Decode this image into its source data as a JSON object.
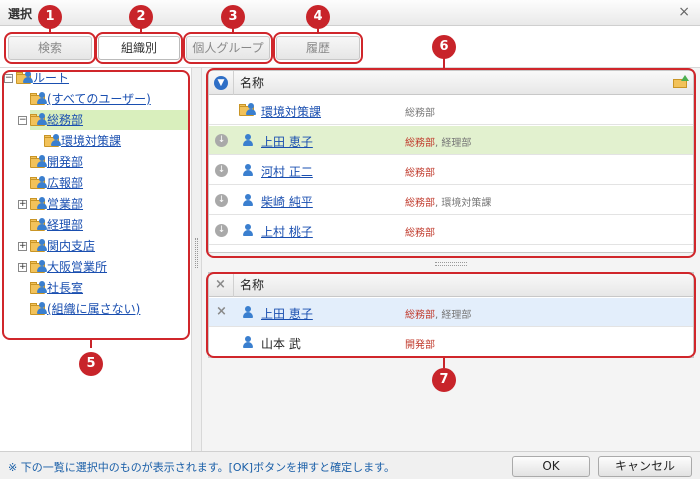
{
  "dialog": {
    "title": "選択",
    "close_glyph": "×"
  },
  "tabs": [
    {
      "label": "検索",
      "badge": "1"
    },
    {
      "label": "組織別",
      "badge": "2"
    },
    {
      "label": "個人グループ",
      "badge": "3"
    },
    {
      "label": "履歴",
      "badge": "4"
    }
  ],
  "tree": {
    "badge": "5",
    "items": [
      {
        "label": "ルート",
        "toggle": "−"
      },
      {
        "label": "(すべてのユーザー)"
      },
      {
        "label": "総務部",
        "toggle": "−"
      },
      {
        "label": "環境対策課"
      },
      {
        "label": "開発部"
      },
      {
        "label": "広報部"
      },
      {
        "label": "営業部",
        "toggle": "+"
      },
      {
        "label": "経理部"
      },
      {
        "label": "関内支店",
        "toggle": "+"
      },
      {
        "label": "大阪営業所",
        "toggle": "+"
      },
      {
        "label": "社長室"
      },
      {
        "label": "(組織に属さない)"
      }
    ]
  },
  "upper_grid": {
    "badge": "6",
    "header": "名称",
    "rows": [
      {
        "name": "環境対策課",
        "dept_red": "総務部",
        "dept_gray": ""
      },
      {
        "name": "上田 恵子",
        "dept_red": "総務部",
        "dept_gray": "経理部"
      },
      {
        "name": "河村 正二",
        "dept_red": "総務部",
        "dept_gray": ""
      },
      {
        "name": "柴崎 純平",
        "dept_red": "総務部",
        "dept_gray": "環境対策課"
      },
      {
        "name": "上村 桃子",
        "dept_red": "総務部",
        "dept_gray": ""
      }
    ]
  },
  "lower_grid": {
    "badge": "7",
    "header": "名称",
    "rows": [
      {
        "name": "上田 恵子",
        "dept_red": "総務部",
        "dept_gray": "経理部"
      },
      {
        "name": "山本 武",
        "dept_red": "開発部",
        "dept_gray": ""
      }
    ]
  },
  "footer": {
    "message": "※ 下の一覧に選択中のものが表示されます。[OK]ボタンを押すと確定します。",
    "ok_label": "OK",
    "cancel_label": "キャンセル"
  },
  "colors": {
    "callout": "#d0262b",
    "selection_green": "#d9efbd",
    "selection_blue": "#e3eefb",
    "link": "#1a4fb0"
  }
}
